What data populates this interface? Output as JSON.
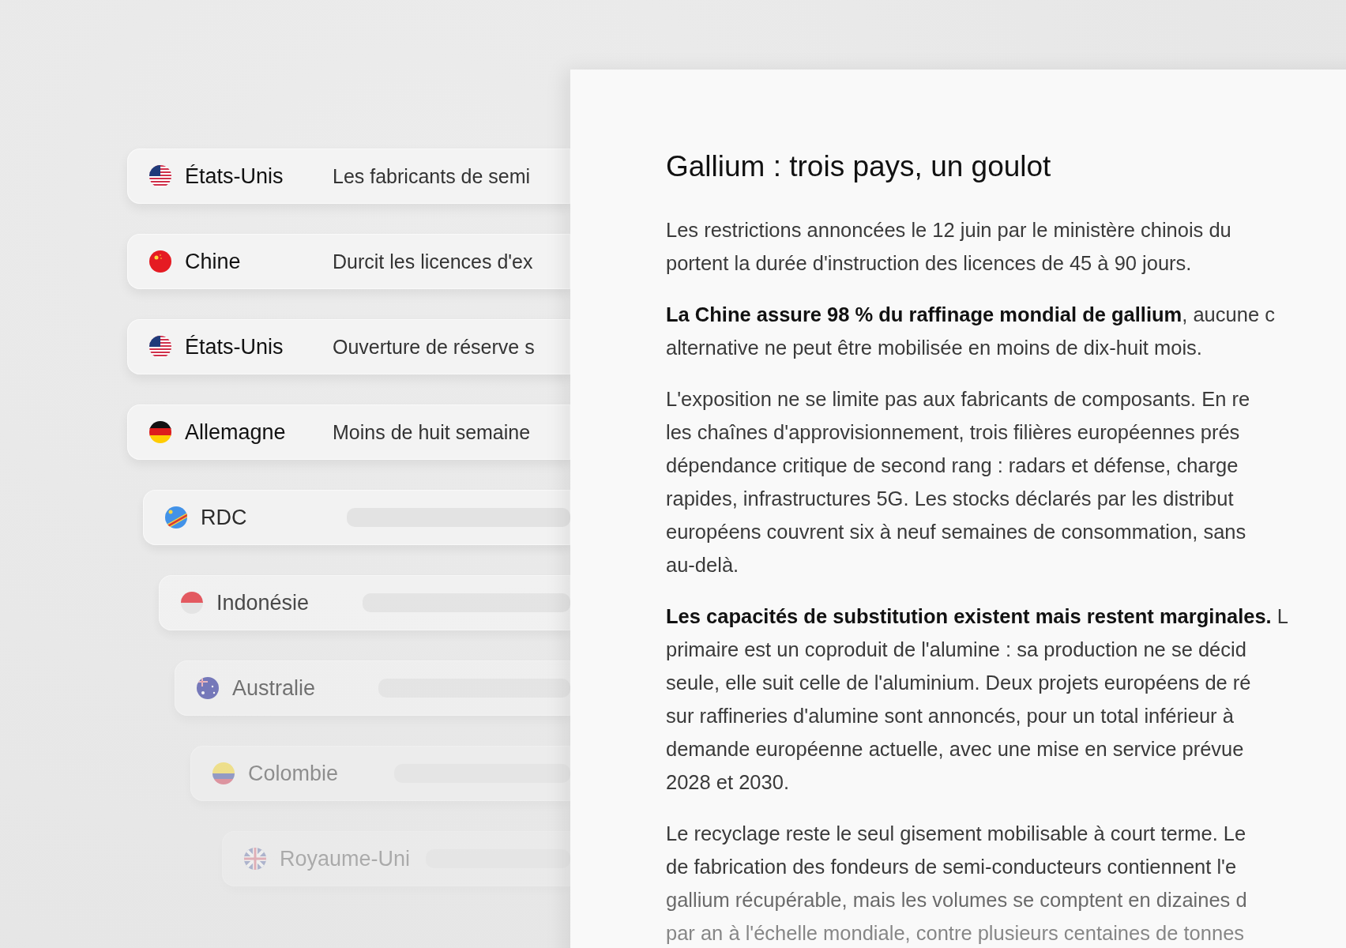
{
  "countries": [
    {
      "kind": "text",
      "name": "États-Unis",
      "summary": "Les fabricants de semi"
    },
    {
      "kind": "text",
      "name": "Chine",
      "summary": "Durcit les licences d'ex"
    },
    {
      "kind": "text",
      "name": "États-Unis",
      "summary": "Ouverture de réserve s"
    },
    {
      "kind": "text",
      "name": "Allemagne",
      "summary": "Moins de huit semaine"
    },
    {
      "kind": "skeleton",
      "name": "RDC"
    },
    {
      "kind": "skeleton",
      "name": "Indonésie"
    },
    {
      "kind": "skeleton",
      "name": "Australie"
    },
    {
      "kind": "skeleton",
      "name": "Colombie"
    },
    {
      "kind": "skeleton",
      "name": "Royaume-Uni"
    }
  ],
  "article": {
    "title": "Gallium : trois pays, un goulot",
    "paragraphs": [
      [
        "Les restrictions annoncées le 12 juin par le ministère chinois du",
        "portent la durée d'instruction des licences de 45 à 90 jours."
      ],
      [
        "**La Chine assure 98 % du raffinage mondial de gallium**, aucune c",
        "alternative ne peut être mobilisée en moins de dix-huit mois."
      ],
      [
        "L'exposition ne se limite pas aux fabricants de composants. En re",
        "les chaînes d'approvisionnement, trois filières européennes prés",
        "dépendance critique de second rang : radars et défense, charge",
        "rapides, infrastructures 5G. Les stocks déclarés par les distribut",
        "européens couvrent six à neuf semaines de consommation, sans",
        "au-delà."
      ],
      [
        "**Les capacités de substitution existent mais restent marginales.** L",
        "primaire est un coproduit de l'alumine : sa production ne se décid",
        "seule, elle suit celle de l'aluminium. Deux projets européens de ré",
        "sur raffineries d'alumine sont annoncés, pour un total inférieur à",
        "demande européenne actuelle, avec une mise en service prévue",
        "2028 et 2030."
      ],
      [
        "Le recyclage reste le seul gisement mobilisable à court terme. Le",
        "de fabrication des fondeurs de semi-conducteurs contiennent l'e",
        "gallium récupérable, mais les volumes se comptent en dizaines d",
        "par an à l'échelle mondiale, contre plusieurs centaines de tonnes"
      ]
    ]
  }
}
